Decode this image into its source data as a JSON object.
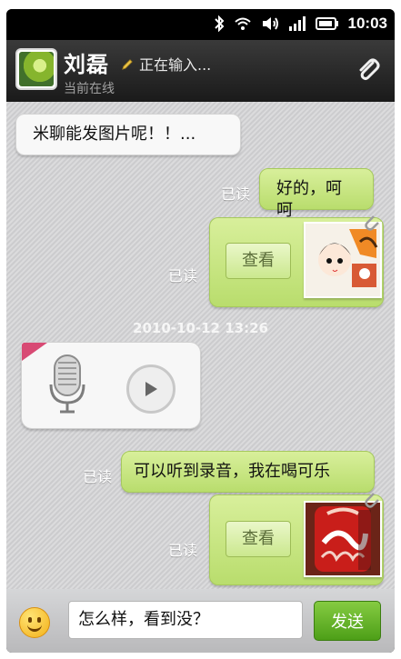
{
  "status": {
    "time": "10:03",
    "icons": [
      "bluetooth-icon",
      "wifi-icon",
      "volume-icon",
      "signal-icon",
      "battery-icon"
    ]
  },
  "header": {
    "name": "刘磊",
    "typing": "正在输入...",
    "presence": "当前在线"
  },
  "messages": {
    "m1": "米聊能发图片呢！！...",
    "m2": "好的，呵呵",
    "read": "已读",
    "view": "查看",
    "timestamp": "2010-10-12 13:26",
    "m3": "可以听到录音，我在喝可乐"
  },
  "input": {
    "value": "怎么样，看到没？",
    "send": "发送"
  },
  "colors": {
    "chatBg": "#d3d3d5",
    "bubbleGreen": "#c7e887",
    "sendGreen": "#5ea72a"
  }
}
